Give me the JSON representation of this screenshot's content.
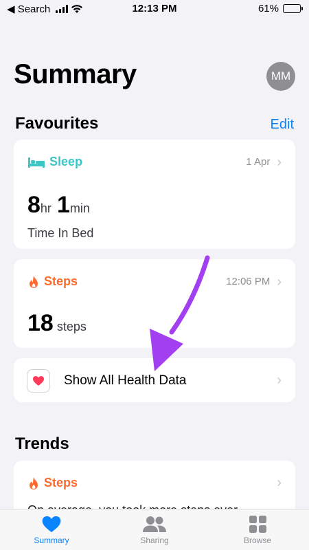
{
  "status_bar": {
    "back_app": "◀ Search",
    "time": "12:13 PM",
    "battery": "61%"
  },
  "header": {
    "title": "Summary",
    "avatar_initials": "MM"
  },
  "favourites": {
    "title": "Favourites",
    "edit_label": "Edit",
    "sleep": {
      "label": "Sleep",
      "date": "1 Apr",
      "hours": "8",
      "hours_unit": "hr",
      "minutes": "1",
      "minutes_unit": "min",
      "caption": "Time In Bed",
      "icon": "bed-icon",
      "color": "#3ec6c6"
    },
    "steps": {
      "label": "Steps",
      "time": "12:06 PM",
      "value": "18",
      "unit": "steps",
      "icon": "flame-icon",
      "color": "#ff6a2c"
    },
    "show_all": {
      "label": "Show All Health Data",
      "icon": "heart-app-icon"
    }
  },
  "trends": {
    "title": "Trends",
    "card": {
      "label": "Steps",
      "icon": "flame-icon",
      "partial_text": "On average, you took more steps ever"
    }
  },
  "tabbar": {
    "tabs": [
      {
        "label": "Summary",
        "icon": "heart-icon",
        "active": true
      },
      {
        "label": "Sharing",
        "icon": "people-icon",
        "active": false
      },
      {
        "label": "Browse",
        "icon": "grid-icon",
        "active": false
      }
    ]
  },
  "annotation": {
    "arrow_color": "#a23ff0"
  }
}
